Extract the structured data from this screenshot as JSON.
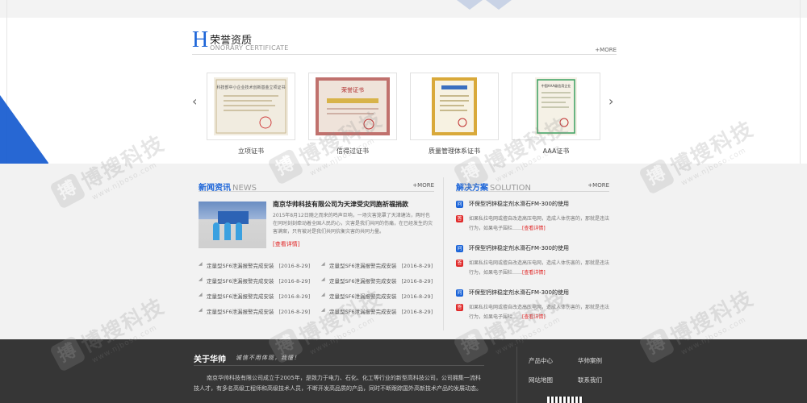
{
  "honor": {
    "title_initial": "H",
    "title": "荣誉资质",
    "subtitle": "ONORARY CERTIFICATE",
    "more": "+MORE",
    "prev_arrow": "‹",
    "next_arrow": "›",
    "certificates": [
      {
        "caption": "立项证书",
        "image_text": "科技部中小企业技术创新基金立项证书"
      },
      {
        "caption": "信得过证书",
        "image_text": "荣誉证书"
      },
      {
        "caption": "质量管理体系证书",
        "image_text": ""
      },
      {
        "caption": "AAA证书",
        "image_text": "中国AAA级信用企业"
      }
    ]
  },
  "news": {
    "title": "新闻资讯",
    "title_en": "NEWS",
    "more": "+MORE",
    "headline": "南京华帅科技有限公司为天津受灾同胞祈福捐款",
    "summary": "2015年8月12日随之而来的鸣声巨响，一场灾害笼罩了天津塘沽，两时也在同时刻刻牵动着全国人民的心，灾害是我们共同的伤痛，在已经发生的灾害满案，只有被对是我们共同抗衡灾害的共同力量。",
    "view_more": "[查看详情]",
    "list_left": [
      {
        "text": "定量型SF6泄漏报警完成安装",
        "date": "[2016-8-29]"
      },
      {
        "text": "定量型SF6泄漏报警完成安装",
        "date": "[2016-8-29]"
      },
      {
        "text": "定量型SF6泄漏报警完成安装",
        "date": "[2016-8-29]"
      },
      {
        "text": "定量型SF6泄漏报警完成安装",
        "date": "[2016-8-29]"
      }
    ],
    "list_right": [
      {
        "text": "定量型SF6泄漏报警完成安装",
        "date": "[2016-8-29]"
      },
      {
        "text": "定量型SF6泄漏报警完成安装",
        "date": "[2016-8-29]"
      },
      {
        "text": "定量型SF6泄漏报警完成安装",
        "date": "[2016-8-29]"
      },
      {
        "text": "定量型SF6泄漏报警完成安装",
        "date": "[2016-8-29]"
      }
    ]
  },
  "solution": {
    "title": "解决方案",
    "title_en": "SOLUTION",
    "more": "+MORE",
    "q_icon": "问",
    "a_icon": "答",
    "items": [
      {
        "question": "环保型钙锌稳定剂水滑石FM-300的使用",
        "answer": "如果私拉电网或擅自改造高压电网，造成人体伤害的，那就是违法行为，如果电子围栏……",
        "view": "[查看详情]"
      },
      {
        "question": "环保型钙锌稳定剂水滑石FM-300的使用",
        "answer": "如果私拉电网或擅自改造高压电网，造成人体伤害的，那就是违法行为，如果电子围栏……",
        "view": "[查看详情]"
      },
      {
        "question": "环保型钙锌稳定剂水滑石FM-300的使用",
        "answer": "如果私拉电网或擅自改造高压电网，造成人体伤害的，那就是违法行为，如果电子围栏……",
        "view": "[查看详情]"
      }
    ]
  },
  "footer": {
    "about_title": "关于华帅",
    "slogan": "诚信不用体现，我懂！",
    "about_text": "南京华帅科技有限公司成立于2005年，是致力于电力、石化、化工等行业的新型高科技公司，公司拥集一流科技人才，有多名高级工程师和高级技术人员，不断开发高品质的产品，同时不断跟踪国外高新技术产品的发展动态。",
    "links": [
      "产品中心",
      "华帅案例",
      "网站地图",
      "联系我们"
    ]
  },
  "watermark": {
    "logo_char": "搏",
    "text": "博搜科技",
    "url": "www.njboso.com"
  },
  "colors": {
    "accent_blue": "#1b64d8",
    "accent_red": "#e02020",
    "footer_bg": "#363636",
    "band_bg": "#f2f2f2"
  }
}
